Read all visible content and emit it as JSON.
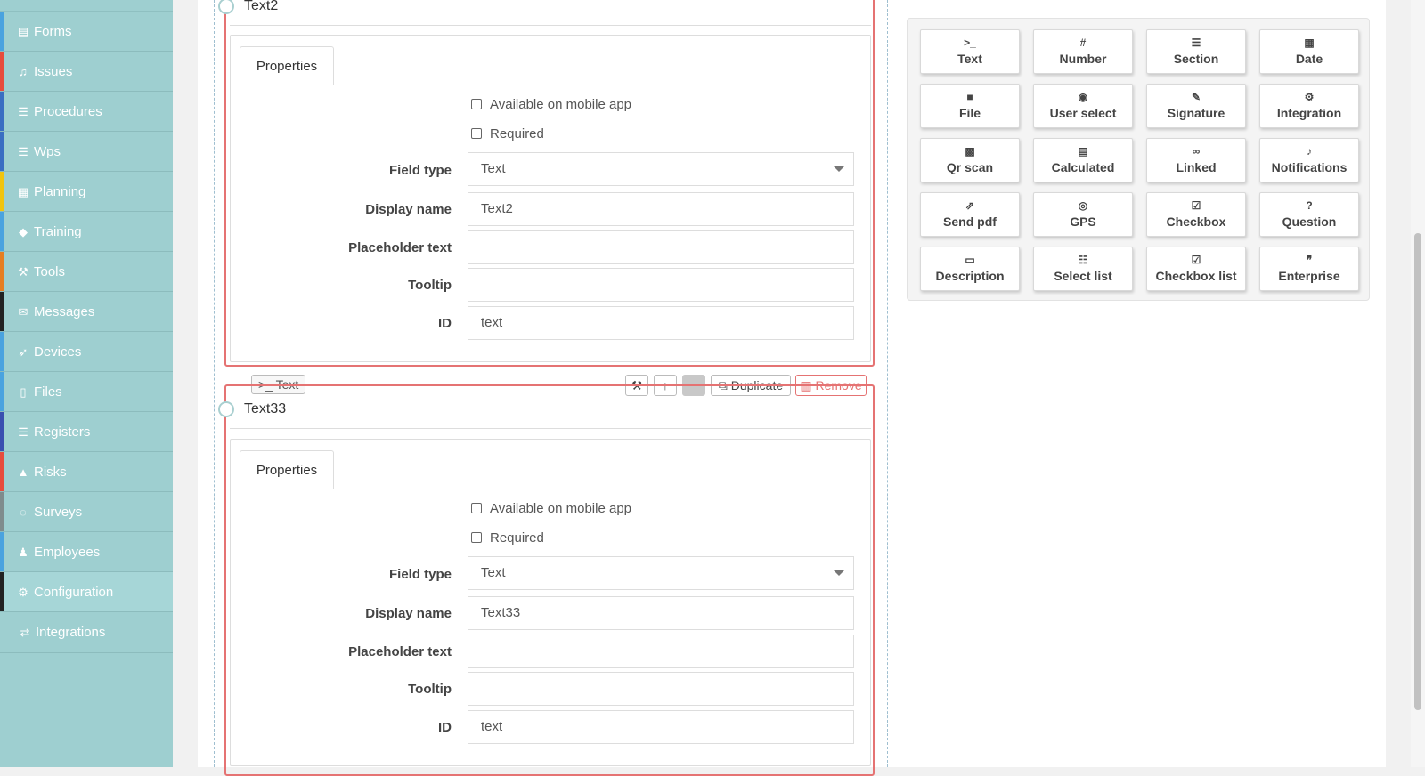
{
  "sidebar": {
    "items": [
      {
        "label": "Forms",
        "icon": "document-icon",
        "stripe": "#4aa3df"
      },
      {
        "label": "Issues",
        "icon": "bell-icon",
        "stripe": "#e74c3c"
      },
      {
        "label": "Procedures",
        "icon": "list-icon",
        "stripe": "#3a6ec2"
      },
      {
        "label": "Wps",
        "icon": "list-icon",
        "stripe": "#3a6ec2"
      },
      {
        "label": "Planning",
        "icon": "calendar-icon",
        "stripe": "#f1c40f"
      },
      {
        "label": "Training",
        "icon": "graduation-cap-icon",
        "stripe": "#4aa3df"
      },
      {
        "label": "Tools",
        "icon": "wrench-icon",
        "stripe": "#e67e22"
      },
      {
        "label": "Messages",
        "icon": "envelope-icon",
        "stripe": "#222222"
      },
      {
        "label": "Devices",
        "icon": "rocket-icon",
        "stripe": "#4aa3df"
      },
      {
        "label": "Files",
        "icon": "file-icon",
        "stripe": "#4aa3df"
      },
      {
        "label": "Registers",
        "icon": "list-icon",
        "stripe": "#3a4fb0"
      },
      {
        "label": "Risks",
        "icon": "warning-icon",
        "stripe": "#e74c3c"
      },
      {
        "label": "Surveys",
        "icon": "comment-icon",
        "stripe": "#7f8c8d"
      },
      {
        "label": "Employees",
        "icon": "users-icon",
        "stripe": "#4aa3df"
      },
      {
        "label": "Configuration",
        "icon": "gear-icon",
        "stripe": "#222222"
      },
      {
        "label": "Integrations",
        "icon": "exchange-icon",
        "stripe": ""
      }
    ]
  },
  "fields": [
    {
      "title": "Text2",
      "tab": "Properties",
      "mobile_label": "Available on mobile app",
      "required_label": "Required",
      "labels": {
        "field_type": "Field type",
        "display_name": "Display name",
        "placeholder": "Placeholder text",
        "tooltip": "Tooltip",
        "id": "ID"
      },
      "values": {
        "field_type": "Text",
        "display_name": "Text2",
        "placeholder": "",
        "tooltip": "",
        "id": "text"
      }
    },
    {
      "title": "Text33",
      "tab": "Properties",
      "mobile_label": "Available on mobile app",
      "required_label": "Required",
      "labels": {
        "field_type": "Field type",
        "display_name": "Display name",
        "placeholder": "Placeholder text",
        "tooltip": "Tooltip",
        "id": "ID"
      },
      "values": {
        "field_type": "Text",
        "display_name": "Text33",
        "placeholder": "",
        "tooltip": "",
        "id": "text"
      }
    }
  ],
  "toolbar": {
    "type_chip": ">_ Text",
    "duplicate_label": "Duplicate",
    "remove_label": "Remove"
  },
  "palette": {
    "items": [
      {
        "label": "Text",
        "icon": "terminal-icon",
        "glyph": ">_"
      },
      {
        "label": "Number",
        "icon": "hash-icon",
        "glyph": "#"
      },
      {
        "label": "Section",
        "icon": "section-icon",
        "glyph": "☰"
      },
      {
        "label": "Date",
        "icon": "calendar-icon",
        "glyph": "▦"
      },
      {
        "label": "File",
        "icon": "file-icon",
        "glyph": "■"
      },
      {
        "label": "User select",
        "icon": "user-circle-icon",
        "glyph": "◉"
      },
      {
        "label": "Signature",
        "icon": "pen-square-icon",
        "glyph": "✎"
      },
      {
        "label": "Integration",
        "icon": "cogs-icon",
        "glyph": "⚙"
      },
      {
        "label": "Qr scan",
        "icon": "qrcode-icon",
        "glyph": "▩"
      },
      {
        "label": "Calculated",
        "icon": "calculator-icon",
        "glyph": "▤"
      },
      {
        "label": "Linked",
        "icon": "link-icon",
        "glyph": "∞"
      },
      {
        "label": "Notifications",
        "icon": "bell-icon",
        "glyph": "♪"
      },
      {
        "label": "Send pdf",
        "icon": "share-square-icon",
        "glyph": "⇗"
      },
      {
        "label": "GPS",
        "icon": "compass-icon",
        "glyph": "◎"
      },
      {
        "label": "Checkbox",
        "icon": "check-square-icon",
        "glyph": "☑"
      },
      {
        "label": "Question",
        "icon": "question-circle-icon",
        "glyph": "?"
      },
      {
        "label": "Description",
        "icon": "file-text-icon",
        "glyph": "▭"
      },
      {
        "label": "Select list",
        "icon": "list-ol-icon",
        "glyph": "☷"
      },
      {
        "label": "Checkbox list",
        "icon": "check-square-icon",
        "glyph": "☑"
      },
      {
        "label": "Enterprise",
        "icon": "quote-icon",
        "glyph": "❞"
      }
    ]
  }
}
